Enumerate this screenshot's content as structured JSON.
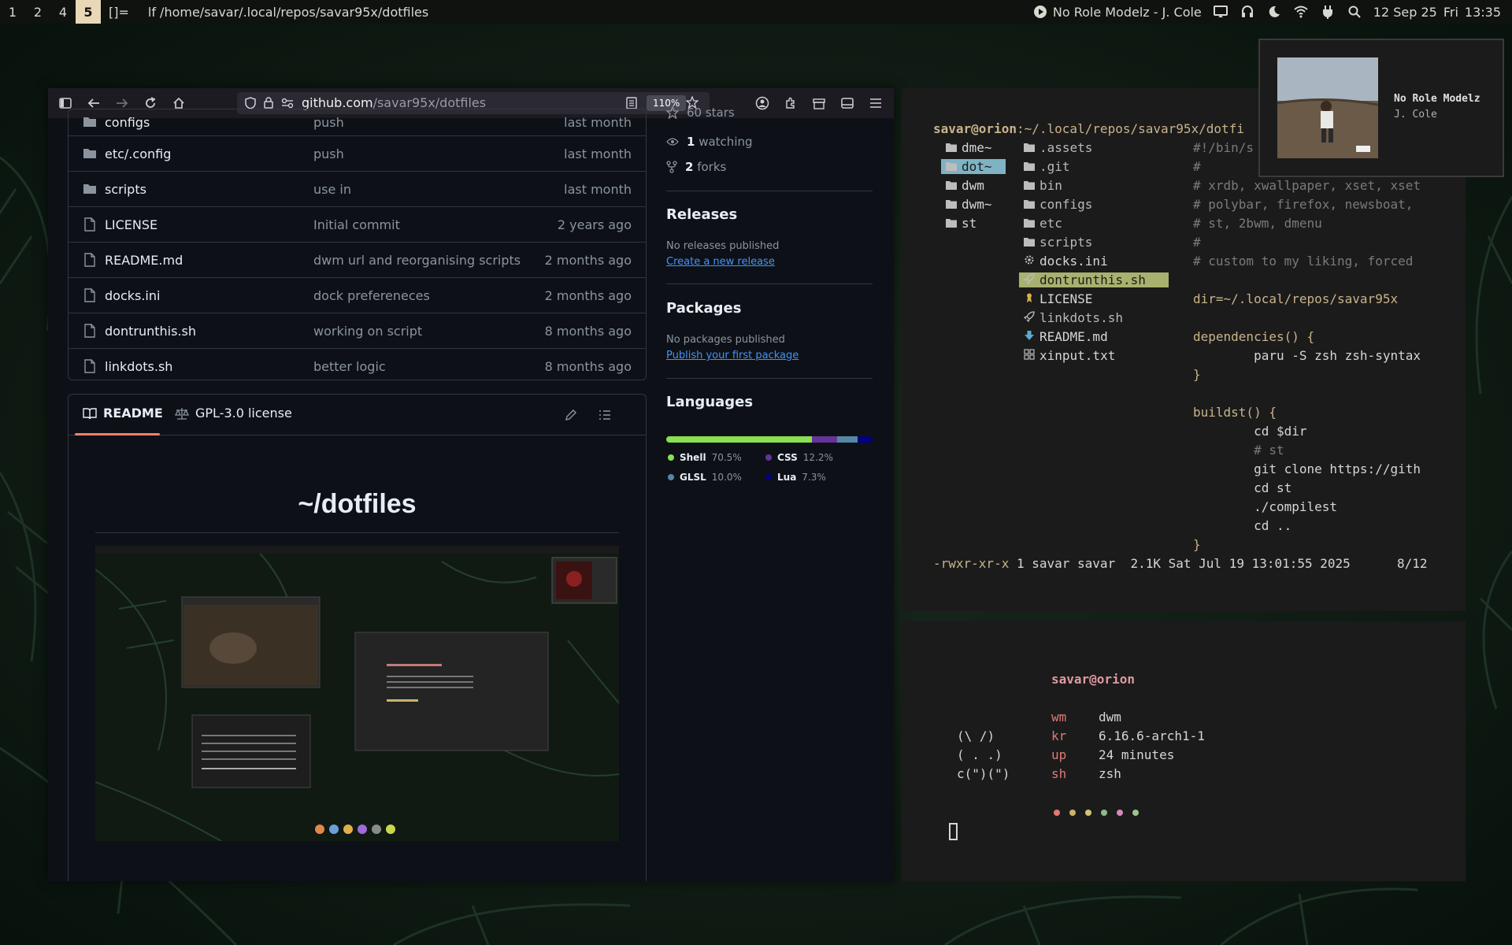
{
  "topbar": {
    "workspaces": [
      {
        "label": "1",
        "active": false
      },
      {
        "label": "2",
        "active": false
      },
      {
        "label": "4",
        "active": false
      },
      {
        "label": "5",
        "active": true
      }
    ],
    "layout_symbol": "[]=",
    "window_title": "lf /home/savar/.local/repos/savar95x/dotfiles",
    "now_playing": "No Role Modelz - J. Cole",
    "date": "12 Sep 25",
    "day": "Fri",
    "time": "13:35",
    "icons": [
      "play-icon",
      "screen-icon",
      "headphones-icon",
      "moon-icon",
      "wifi-icon",
      "power-plug-icon",
      "search-icon"
    ]
  },
  "browser": {
    "url_domain": "github.com",
    "url_path": "/savar95x/dotfiles",
    "zoom": "110%",
    "files": [
      {
        "name": "configs",
        "type": "dir",
        "message": "push",
        "date": "last month"
      },
      {
        "name": "etc/.config",
        "type": "dir",
        "message": "push",
        "date": "last month"
      },
      {
        "name": "scripts",
        "type": "dir",
        "message": "use in",
        "date": "last month"
      },
      {
        "name": "LICENSE",
        "type": "file",
        "message": "Initial commit",
        "date": "2 years ago"
      },
      {
        "name": "README.md",
        "type": "file",
        "message": "dwm url and reorganising scripts",
        "date": "2 months ago"
      },
      {
        "name": "docks.ini",
        "type": "file",
        "message": "dock prefereneces",
        "date": "2 months ago"
      },
      {
        "name": "dontrunthis.sh",
        "type": "file",
        "message": "working on script",
        "date": "8 months ago"
      },
      {
        "name": "linkdots.sh",
        "type": "file",
        "message": "better logic",
        "date": "8 months ago"
      }
    ],
    "readme_tab": "README",
    "license_tab": "GPL-3.0 license",
    "readme_title": "~/dotfiles",
    "sidebar": {
      "stars": "60 stars",
      "watching_count": "1",
      "watching_label": "watching",
      "forks_count": "2",
      "forks_label": "forks",
      "releases_heading": "Releases",
      "releases_none": "No releases published",
      "releases_link": "Create a new release",
      "packages_heading": "Packages",
      "packages_none": "No packages published",
      "packages_link": "Publish your first package",
      "languages_heading": "Languages",
      "languages": [
        {
          "name": "Shell",
          "percent": 70.5,
          "label": "70.5%",
          "color": "#89e051"
        },
        {
          "name": "CSS",
          "percent": 12.2,
          "label": "12.2%",
          "color": "#663399"
        },
        {
          "name": "GLSL",
          "percent": 10.0,
          "label": "10.0%",
          "color": "#5686a5"
        },
        {
          "name": "Lua",
          "percent": 7.3,
          "label": "7.3%",
          "color": "#000080"
        }
      ]
    }
  },
  "lf": {
    "header_user": "savar@orion",
    "header_path": ":~/.local/repos/savar95x/dotfi",
    "parent_items": [
      "dme~",
      "dot~",
      "dwm",
      "dwm~",
      "st"
    ],
    "current_items": [
      ".assets",
      ".git",
      "bin",
      "configs",
      "etc",
      "scripts",
      "docks.ini",
      "dontrunthis.sh",
      "LICENSE",
      "linkdots.sh",
      "README.md",
      "xinput.txt"
    ],
    "preview": [
      "#!/bin/s",
      "#",
      "# xrdb, xwallpaper, xset, xset",
      "# polybar, firefox, newsboat,",
      "# st, 2bwm, dmenu",
      "#",
      "# custom to my liking, forced",
      "",
      "dir=~/.local/repos/savar95x",
      "",
      "dependencies() {",
      "        paru -S zsh zsh-syntax",
      "}",
      "",
      "buildst() {",
      "        cd $dir",
      "        # st",
      "        git clone https://gith",
      "        cd st",
      "        ./compilest",
      "        cd ..",
      "}"
    ],
    "status_perms": "-rwxr-xr-x",
    "status_info": "1 savar savar  2.1K Sat Jul 19 13:01:55 2025",
    "status_pos": "8/12"
  },
  "fetch": {
    "user_host": "savar@orion",
    "ascii": [
      "(\\ /)",
      "( . .)",
      "c(\")(\")"
    ],
    "rows": [
      {
        "key": "wm",
        "value": "dwm"
      },
      {
        "key": "kr",
        "value": "6.16.6-arch1-1"
      },
      {
        "key": "up",
        "value": "24 minutes"
      },
      {
        "key": "sh",
        "value": "zsh"
      }
    ],
    "dot_colors": [
      "#e27878",
      "#c9b46a",
      "#d4c27a",
      "#8fb88a",
      "#d48ab8",
      "#9ec48a"
    ]
  },
  "notification": {
    "title": "No Role Modelz",
    "artist": "J. Cole"
  }
}
